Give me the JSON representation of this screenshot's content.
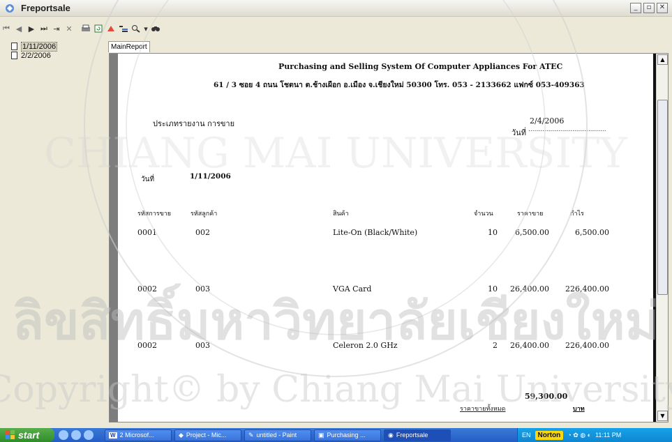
{
  "window": {
    "title": "Freportsale",
    "buttons": [
      "_",
      "▫",
      "✕"
    ]
  },
  "toolbar": {
    "icons": [
      "first-page-icon",
      "prev-page-icon",
      "next-page-icon",
      "last-page-icon",
      "goto-page-icon",
      "close-report-icon",
      "print-icon",
      "refresh-icon",
      "export-icon",
      "group-tree-icon",
      "zoom-icon",
      "dropdown-icon",
      "search-icon"
    ]
  },
  "tree": {
    "items": [
      {
        "label": "1/11/2006",
        "selected": true
      },
      {
        "label": "2/2/2006",
        "selected": false
      }
    ]
  },
  "tabs": [
    {
      "label": "MainReport"
    }
  ],
  "report": {
    "title": "Purchasing and Selling System  Of Computer Appliances For ATEC",
    "address": "61 / 3  ซอย 4 ถนน โชตนา ต.ช้างเผือก อ.เมือง จ.เชียงใหม่ 50300 โทร. 053 - 2133662 แฟกซ์ 053-409363",
    "report_type_label": "ประเภทรายงาน การขาย",
    "date_label": "วันที่",
    "date_value": "2/4/2006",
    "date_dots": ".......................................",
    "group_date_label": "วันที่",
    "group_date_value": "1/11/2006",
    "columns": [
      "รหัสการขาย",
      "รหัสลูกค้า",
      "สินค้า",
      "จำนวน",
      "ราคาขาย",
      "กำไร"
    ],
    "rows": [
      {
        "sale_id": "0001",
        "customer_id": "002",
        "product": "Lite-On (Black/White)",
        "qty": "10",
        "price": "6,500.00",
        "profit": "6,500.00"
      },
      {
        "sale_id": "0002",
        "customer_id": "003",
        "product": "VGA Card",
        "qty": "10",
        "price": "26,400.00",
        "profit": "226,400.00"
      },
      {
        "sale_id": "0002",
        "customer_id": "003",
        "product": "Celeron 2.0 GHz",
        "qty": "2",
        "price": "26,400.00",
        "profit": "226,400.00"
      }
    ],
    "total_label": "ราคาขายทั้งหมด",
    "total_value": "59,300.00",
    "currency": "บาท"
  },
  "watermark": {
    "line1": "ลิขสิทธิ์มหาวิทยาลัยเชียงใหม่",
    "line2": "Copyright© by Chiang Mai University",
    "ring_text": "CHIANG MAI UNIVERSITY",
    "color": "#c8c8c8"
  },
  "taskbar": {
    "start_label": "start",
    "tasks": [
      "2 Microsof...",
      "Project - Mic...",
      "untitled - Paint",
      "Purchasing ...",
      "Freportsale"
    ],
    "tray_lang": "EN",
    "norton_label": "Norton",
    "clock": "11:11 PM"
  }
}
